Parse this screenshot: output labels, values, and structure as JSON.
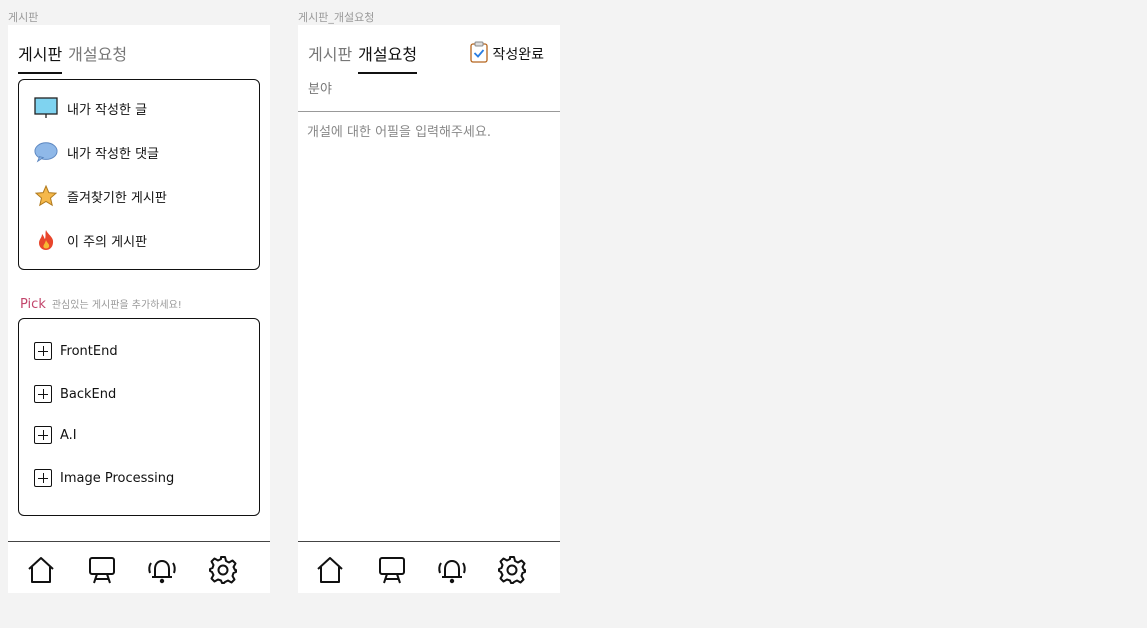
{
  "left": {
    "frame_label": "게시판",
    "tabs": [
      {
        "label": "게시판",
        "active": true
      },
      {
        "label": "개설요청",
        "active": false
      }
    ],
    "menu": [
      {
        "label": "내가 작성한 글",
        "icon": "board-icon"
      },
      {
        "label": "내가 작성한 댓글",
        "icon": "speech-bubble-icon"
      },
      {
        "label": "즐겨찾기한 게시판",
        "icon": "star-icon"
      },
      {
        "label": "이 주의 게시판",
        "icon": "fire-icon"
      }
    ],
    "pick": {
      "title": "Pick",
      "subtitle": "관심있는 게시판을 추가하세요!",
      "items": [
        "FrontEnd",
        "BackEnd",
        "A.I",
        "Image Processing"
      ]
    }
  },
  "right": {
    "frame_label": "게시판_개설요청",
    "tabs": [
      {
        "label": "게시판",
        "active": false
      },
      {
        "label": "개설요청",
        "active": true
      }
    ],
    "done_label": "작성완료",
    "field_label": "분야",
    "body_placeholder": "개설에 대한 어필을 입력해주세요."
  },
  "nav": [
    "home-icon",
    "board-icon",
    "bell-icon",
    "gear-icon"
  ],
  "colors": {
    "pick_accent": "#c2456b",
    "background": "#f3f3f3",
    "board_screen": "#7fd3f0",
    "bubble": "#8fb8e8",
    "star": "#f5b84a"
  }
}
